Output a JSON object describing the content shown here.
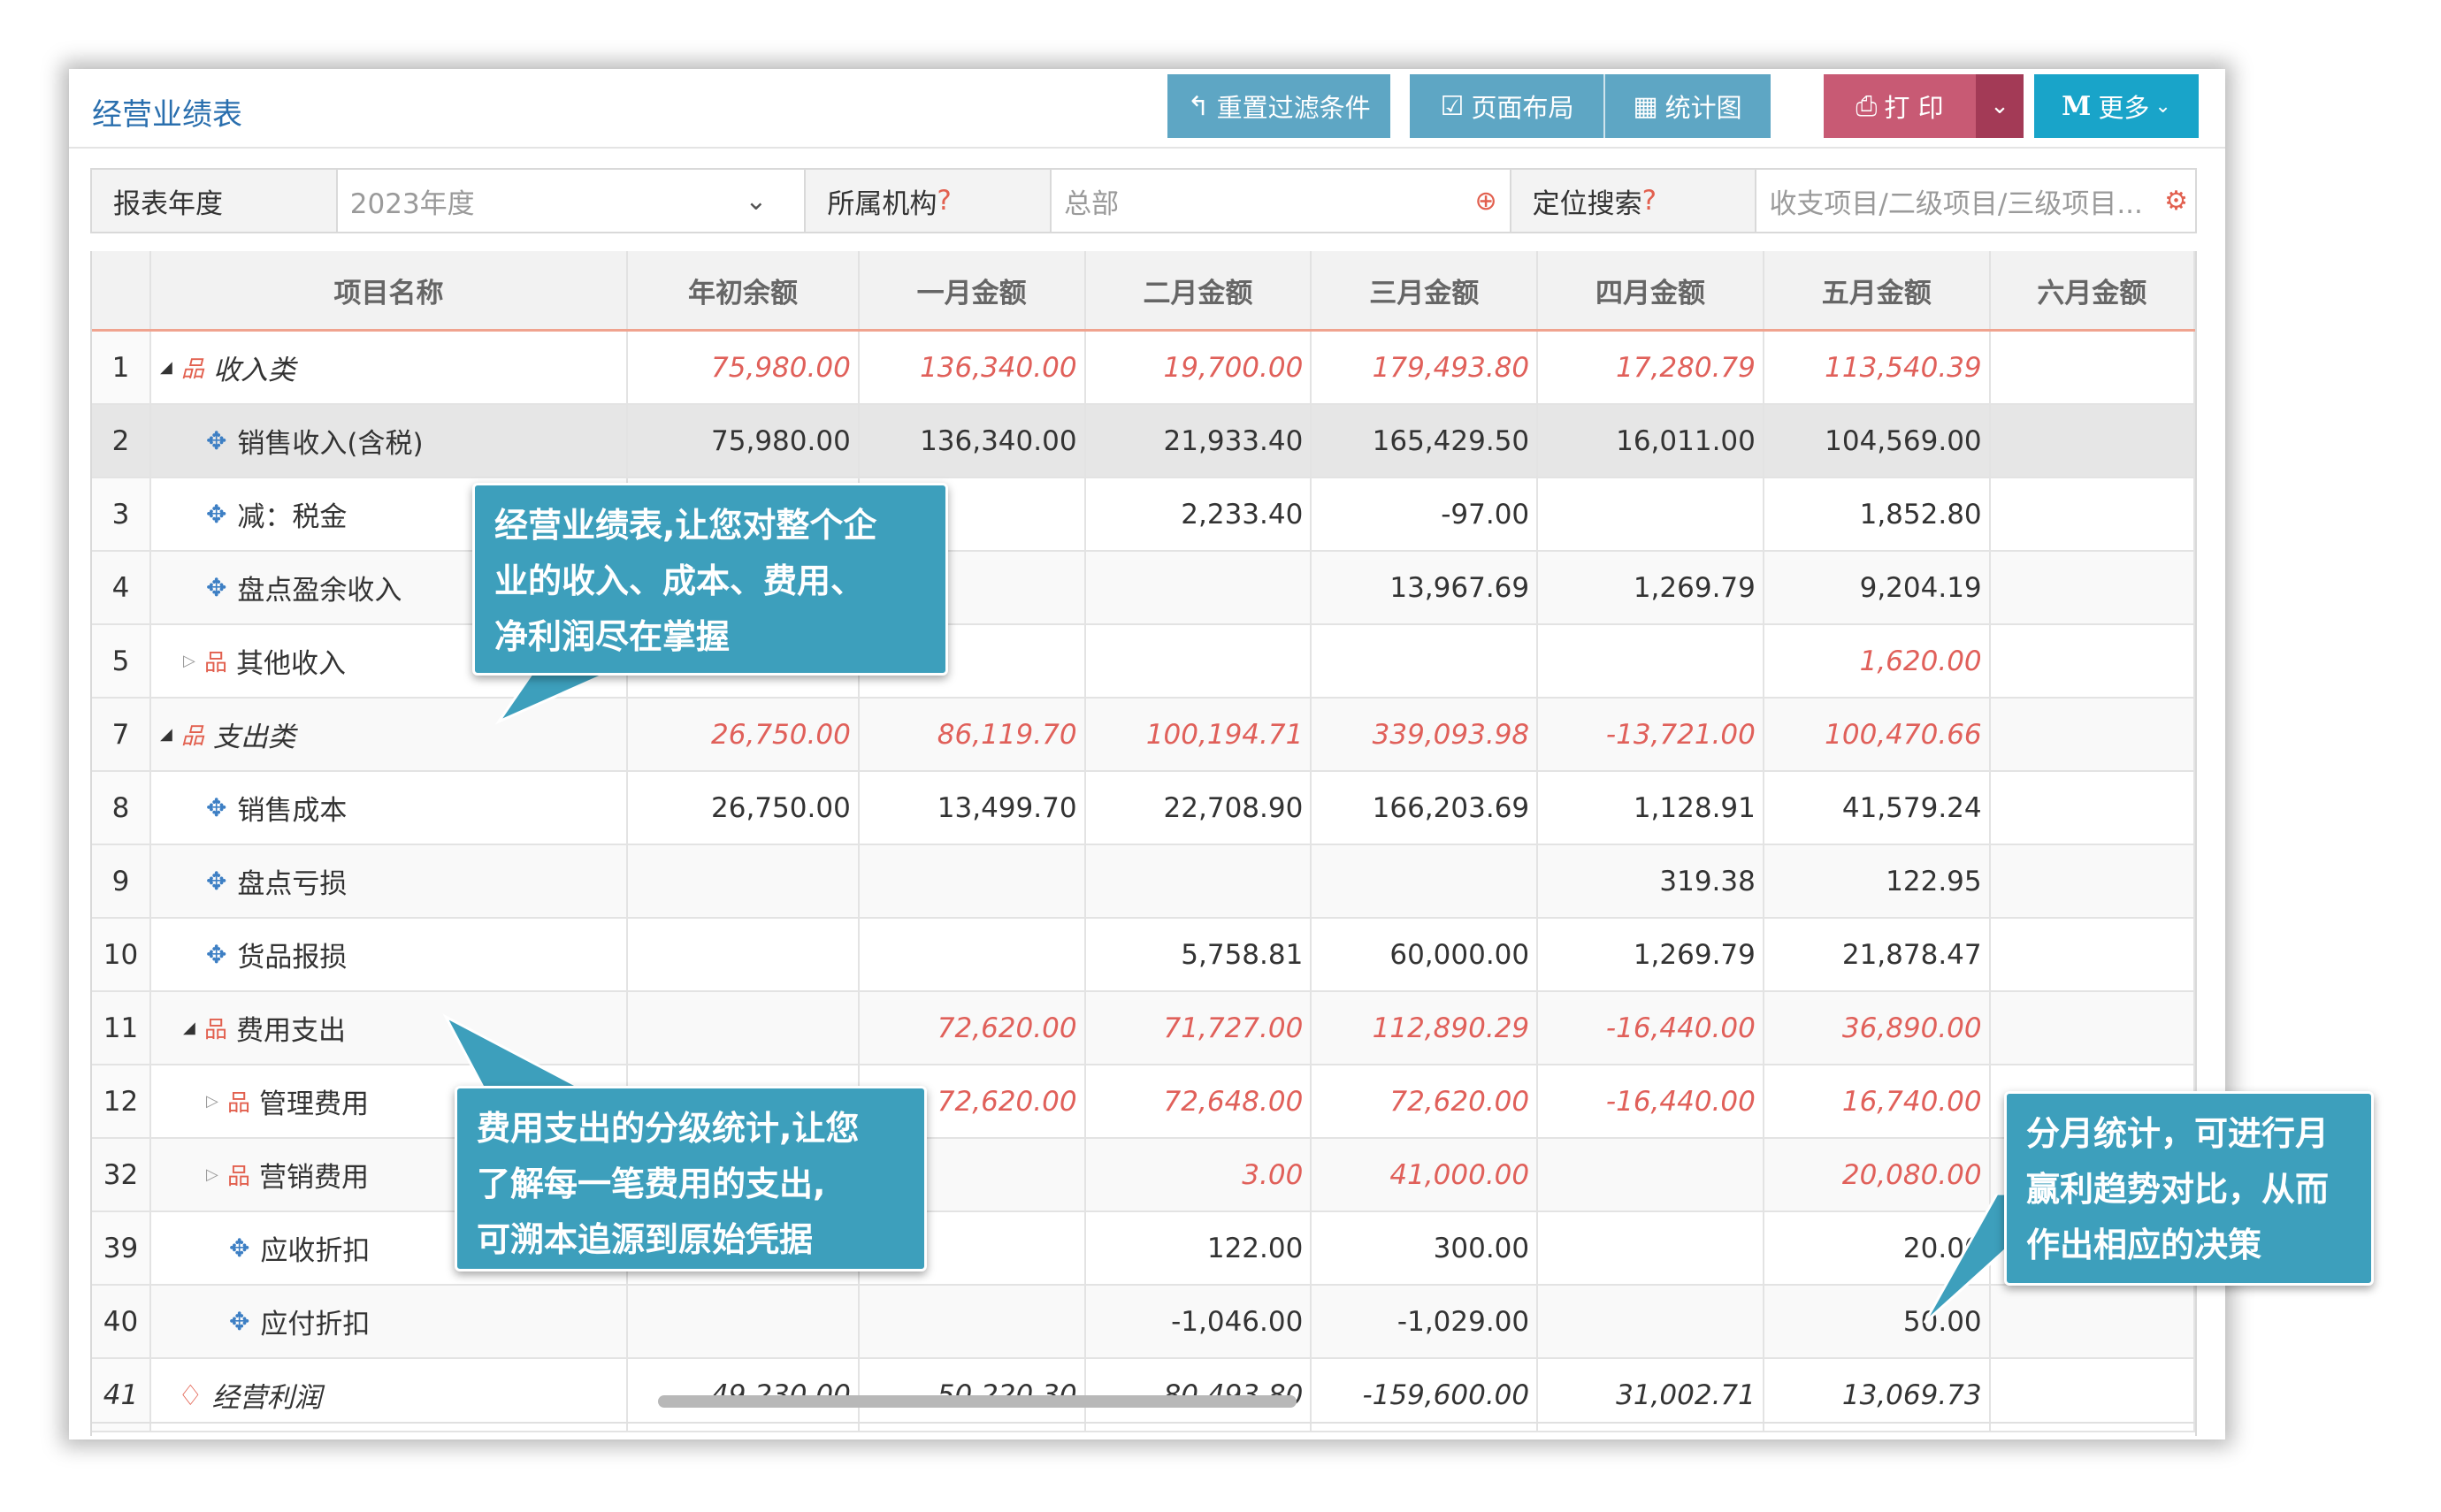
{
  "window": {
    "title": "经营业绩表"
  },
  "toolbar": {
    "reset_filter": "重置过滤条件",
    "page_layout": "页面布局",
    "chart": "统计图",
    "print": "打 印",
    "more": "更多"
  },
  "filters": {
    "year_label": "报表年度",
    "year_value": "2023年度",
    "org_label": "所属机构",
    "org_qmark": "?",
    "org_value": "总部",
    "search_label": "定位搜索",
    "search_qmark": "?",
    "search_placeholder": "收支项目/二级项目/三级项目..."
  },
  "table": {
    "columns": [
      "项目名称",
      "年初余额",
      "一月金额",
      "二月金额",
      "三月金额",
      "四月金额",
      "五月金额",
      "六月金额"
    ],
    "rows": [
      {
        "idx": "1",
        "name": "收入类",
        "values": [
          "75,980.00",
          "136,340.00",
          "19,700.00",
          "179,493.80",
          "17,280.79",
          "113,540.39",
          ""
        ]
      },
      {
        "idx": "2",
        "name": "销售收入(含税)",
        "values": [
          "75,980.00",
          "136,340.00",
          "21,933.40",
          "165,429.50",
          "16,011.00",
          "104,569.00",
          ""
        ]
      },
      {
        "idx": "3",
        "name": "减：税金",
        "values": [
          "",
          "",
          "2,233.40",
          "-97.00",
          "",
          "1,852.80",
          ""
        ]
      },
      {
        "idx": "4",
        "name": "盘点盈余收入",
        "values": [
          "",
          "",
          "",
          "13,967.69",
          "1,269.79",
          "9,204.19",
          ""
        ]
      },
      {
        "idx": "5",
        "name": "其他收入",
        "values": [
          "",
          "",
          "",
          "",
          "",
          "1,620.00",
          ""
        ]
      },
      {
        "idx": "7",
        "name": "支出类",
        "values": [
          "26,750.00",
          "86,119.70",
          "100,194.71",
          "339,093.98",
          "-13,721.00",
          "100,470.66",
          ""
        ]
      },
      {
        "idx": "8",
        "name": "销售成本",
        "values": [
          "26,750.00",
          "13,499.70",
          "22,708.90",
          "166,203.69",
          "1,128.91",
          "41,579.24",
          ""
        ]
      },
      {
        "idx": "9",
        "name": "盘点亏损",
        "values": [
          "",
          "",
          "",
          "",
          "319.38",
          "122.95",
          ""
        ]
      },
      {
        "idx": "10",
        "name": "货品报损",
        "values": [
          "",
          "",
          "5,758.81",
          "60,000.00",
          "1,269.79",
          "21,878.47",
          ""
        ]
      },
      {
        "idx": "11",
        "name": "费用支出",
        "values": [
          "",
          "72,620.00",
          "71,727.00",
          "112,890.29",
          "-16,440.00",
          "36,890.00",
          ""
        ]
      },
      {
        "idx": "12",
        "name": "管理费用",
        "values": [
          "",
          "72,620.00",
          "72,648.00",
          "72,620.00",
          "-16,440.00",
          "16,740.00",
          ""
        ]
      },
      {
        "idx": "32",
        "name": "营销费用",
        "values": [
          "",
          "",
          "3.00",
          "41,000.00",
          "",
          "20,080.00",
          ""
        ]
      },
      {
        "idx": "39",
        "name": "应收折扣",
        "values": [
          "",
          "",
          "122.00",
          "300.00",
          "",
          "20.00",
          ""
        ]
      },
      {
        "idx": "40",
        "name": "应付折扣",
        "values": [
          "",
          "",
          "-1,046.00",
          "-1,029.00",
          "",
          "50.00",
          ""
        ]
      },
      {
        "idx": "41",
        "name": "经营利润",
        "values": [
          "49,230.00",
          "50,220.30",
          "-80,493.80",
          "-159,600.00",
          "31,002.71",
          "13,069.73",
          ""
        ]
      }
    ]
  },
  "callouts": {
    "c1": [
      "经营业绩表,让您对整个企",
      "业的收入、成本、费用、",
      "净利润尽在掌握"
    ],
    "c2": [
      "费用支出的分级统计,让您",
      "了解每一笔费用的支出,",
      "可溯本追源到原始凭据"
    ],
    "c3": [
      "分月统计，可进行月",
      "赢利趋势对比，从而",
      "作出相应的决策"
    ]
  },
  "colors": {
    "accent_red": "#e0605a",
    "button_blue": "#5ea6c4",
    "print_red": "#c85a74",
    "more_cyan": "#19a4c9",
    "callout_blue": "#3d9fbc"
  },
  "icons": {
    "reset": "undo-arrow-icon",
    "layout": "check-square-icon",
    "chart": "grid-icon",
    "print": "printer-icon",
    "more": "m-logo-icon"
  }
}
